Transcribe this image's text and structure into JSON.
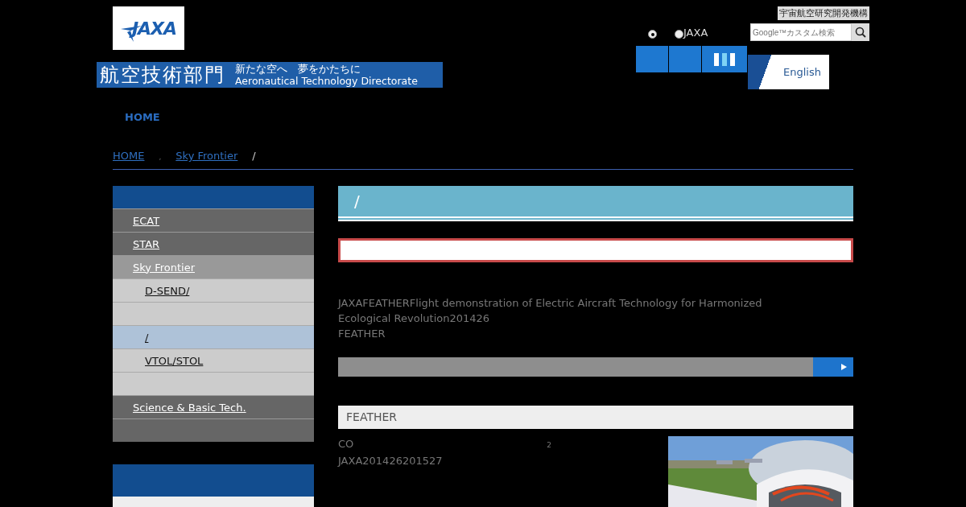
{
  "header": {
    "logo": "JAXA",
    "banner_title": "航空技術部門",
    "banner_slogan": "新たな空へ　夢をかたちに",
    "banner_subtitle": "Aeronautical Technology Directorate",
    "org_link": "宇宙航空研究開発機構",
    "search_scope": [
      {
        "selected": true
      },
      {
        "label": "JAXA",
        "selected": false
      }
    ],
    "search": {
      "placeholder": "Google™カスタム検索"
    },
    "language": "English"
  },
  "global_nav": [
    "HOME"
  ],
  "breadcrumb": [
    {
      "label": "HOME",
      "kind": "link"
    },
    {
      "label": ",",
      "kind": "sep"
    },
    {
      "label": "Sky Frontier",
      "kind": "link"
    },
    {
      "label": "/",
      "kind": "current"
    }
  ],
  "sidebar": {
    "items": [
      {
        "label": "ECAT",
        "selected": false
      },
      {
        "label": "STAR",
        "selected": false
      },
      {
        "label": "Sky Frontier",
        "selected": false,
        "children": [
          {
            "label": "D-SEND/",
            "selected": false
          },
          {
            "selected": false
          },
          {
            "label": "/",
            "selected": true
          },
          {
            "label": "VTOL/STOL",
            "selected": false
          },
          {
            "selected": false
          }
        ]
      },
      {
        "label": "Science & Basic Tech.",
        "selected": false
      },
      {
        "selected": false
      }
    ]
  },
  "main": {
    "title": "/",
    "intro": [
      "JAXAFEATHERFlight demonstration of Electric Aircraft Technology for Harmonized Ecological Revolution201426",
      "FEATHER"
    ],
    "section_title": "FEATHER",
    "section_text": [
      {
        "text": "CO",
        "sub": "2"
      },
      {
        "text": "JAXA201426201527"
      }
    ]
  }
}
